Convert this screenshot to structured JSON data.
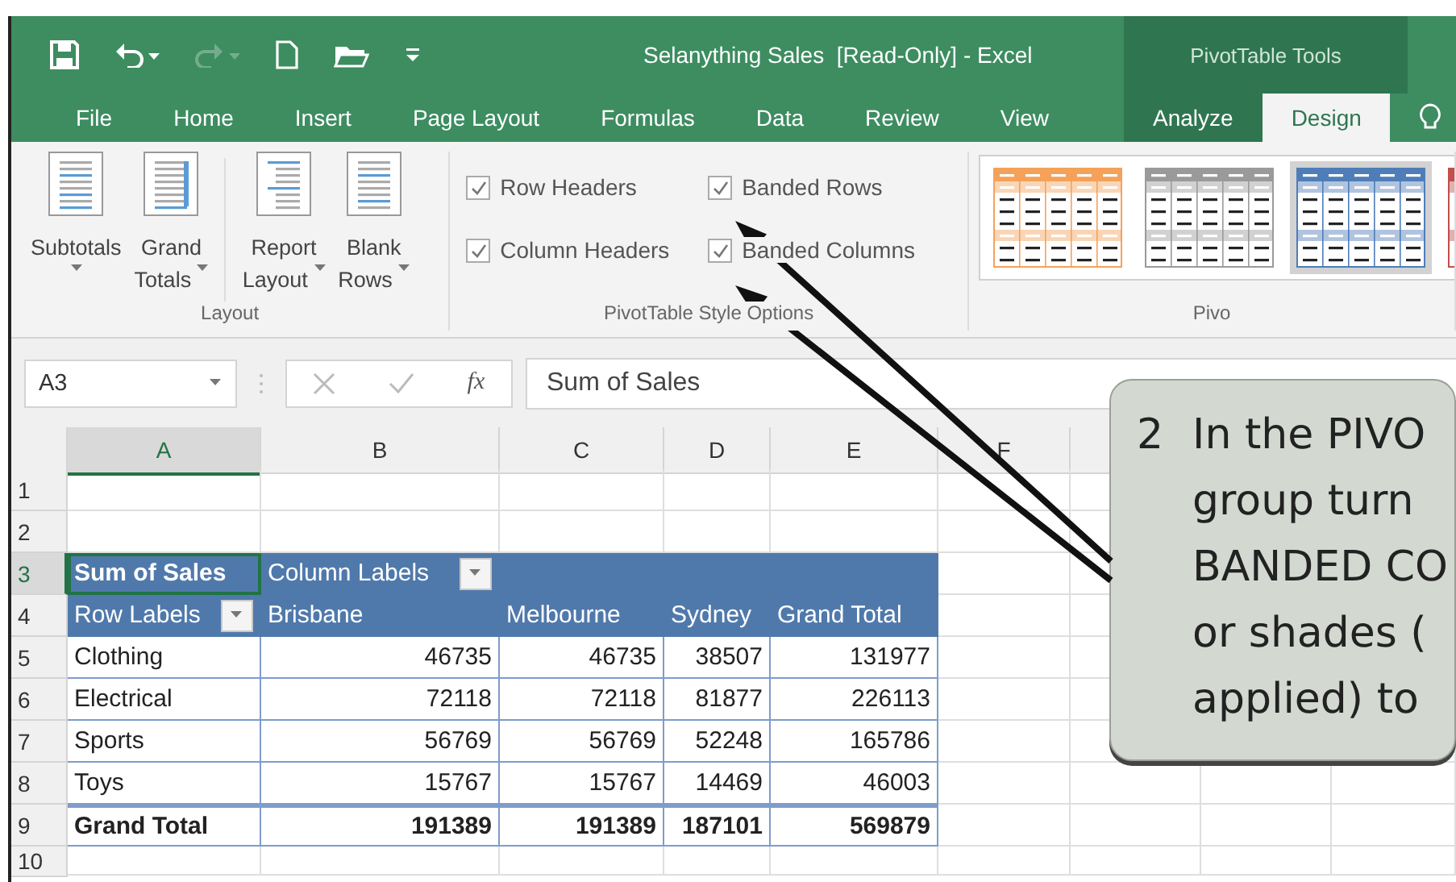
{
  "window": {
    "title": "Selanything Sales  [Read-Only] - Excel",
    "contextual_title": "PivotTable Tools",
    "redo_disabled": true
  },
  "tabs": [
    {
      "label": "File",
      "selected": false,
      "contextual": false
    },
    {
      "label": "Home",
      "selected": false,
      "contextual": false
    },
    {
      "label": "Insert",
      "selected": false,
      "contextual": false
    },
    {
      "label": "Page Layout",
      "selected": false,
      "contextual": false
    },
    {
      "label": "Formulas",
      "selected": false,
      "contextual": false
    },
    {
      "label": "Data",
      "selected": false,
      "contextual": false
    },
    {
      "label": "Review",
      "selected": false,
      "contextual": false
    },
    {
      "label": "View",
      "selected": false,
      "contextual": false
    },
    {
      "label": "Analyze",
      "selected": false,
      "contextual": true
    },
    {
      "label": "Design",
      "selected": true,
      "contextual": true
    }
  ],
  "ribbon": {
    "layout_group": {
      "label": "Layout",
      "buttons": [
        {
          "lines": [
            "Subtotals"
          ],
          "kind": "subtotals"
        },
        {
          "lines": [
            "Grand",
            "Totals"
          ],
          "kind": "totals"
        },
        {
          "lines": [
            "Report",
            "Layout"
          ],
          "kind": "report"
        },
        {
          "lines": [
            "Blank",
            "Rows"
          ],
          "kind": "blank"
        }
      ]
    },
    "style_options": {
      "label": "PivotTable Style Options",
      "options": [
        {
          "label": "Row Headers",
          "checked": true
        },
        {
          "label": "Column Headers",
          "checked": true
        },
        {
          "label": "Banded Rows",
          "checked": true
        },
        {
          "label": "Banded Columns",
          "checked": true
        }
      ]
    },
    "styles": {
      "label": "Pivo",
      "items": [
        {
          "color": "#f4a25a",
          "selected": false
        },
        {
          "color": "#9a9a9a",
          "selected": false
        },
        {
          "color": "#4f7db8",
          "selected": true
        },
        {
          "color": "#c0504d",
          "selected": false
        }
      ]
    }
  },
  "formula_bar": {
    "name_box": "A3",
    "function_label": "fx",
    "value": "Sum of Sales"
  },
  "sheet": {
    "columns": [
      {
        "label": "A",
        "selected": true
      },
      {
        "label": "B",
        "selected": false
      },
      {
        "label": "C",
        "selected": false
      },
      {
        "label": "D",
        "selected": false
      },
      {
        "label": "E",
        "selected": false
      },
      {
        "label": "F",
        "selected": false
      }
    ],
    "rows": [
      {
        "label": "1",
        "selected": false
      },
      {
        "label": "2",
        "selected": false
      },
      {
        "label": "3",
        "selected": true
      },
      {
        "label": "4",
        "selected": false
      },
      {
        "label": "5",
        "selected": false
      },
      {
        "label": "6",
        "selected": false
      },
      {
        "label": "7",
        "selected": false
      },
      {
        "label": "8",
        "selected": false
      },
      {
        "label": "9",
        "selected": false
      },
      {
        "label": "10",
        "selected": false
      }
    ]
  },
  "pivot": {
    "value_field": "Sum of Sales",
    "column_labels": "Column Labels",
    "row_labels": "Row Labels",
    "columns": [
      "Brisbane",
      "Melbourne",
      "Sydney",
      "Grand Total"
    ],
    "rows": [
      {
        "label": "Clothing",
        "values": [
          "46735",
          "46735",
          "38507",
          "131977"
        ]
      },
      {
        "label": "Electrical",
        "values": [
          "72118",
          "72118",
          "81877",
          "226113"
        ]
      },
      {
        "label": "Sports",
        "values": [
          "56769",
          "56769",
          "52248",
          "165786"
        ]
      },
      {
        "label": "Toys",
        "values": [
          "15767",
          "15767",
          "14469",
          "46003"
        ]
      }
    ],
    "total": {
      "label": "Grand Total",
      "values": [
        "191389",
        "191389",
        "187101",
        "569879"
      ]
    }
  },
  "callout": {
    "number": "2",
    "lines": [
      "In the PIVO",
      "group turn",
      "BANDED CO",
      "or shades (",
      "applied) to"
    ]
  }
}
